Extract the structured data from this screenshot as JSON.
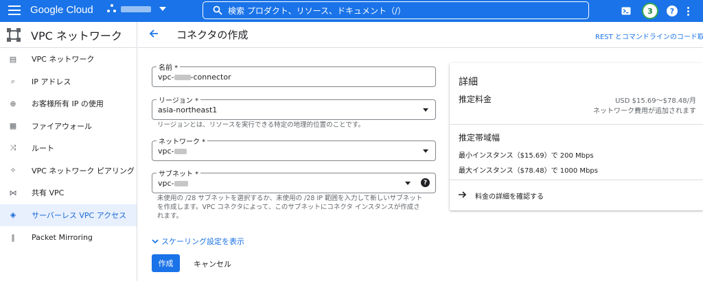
{
  "topbar": {
    "logo": "Google Cloud",
    "search_placeholder": "検索  プロダクト、リソース、ドキュメント（/）",
    "notifications_count": "3",
    "help_label": "?"
  },
  "sidebar": {
    "title": "VPC ネットワーク",
    "items": [
      {
        "label": "VPC ネットワーク",
        "icon": "vpc-networks-icon",
        "glyph": "▤"
      },
      {
        "label": "IP アドレス",
        "icon": "ip-address-icon",
        "glyph": "⌕"
      },
      {
        "label": "お客様所有 IP の使用",
        "icon": "globe-icon",
        "glyph": "⊕"
      },
      {
        "label": "ファイアウォール",
        "icon": "firewall-icon",
        "glyph": "▦"
      },
      {
        "label": "ルート",
        "icon": "routes-icon",
        "glyph": "⤨"
      },
      {
        "label": "VPC ネットワーク ピアリング",
        "icon": "peering-icon",
        "glyph": "✧"
      },
      {
        "label": "共有 VPC",
        "icon": "shared-vpc-icon",
        "glyph": "⋈"
      },
      {
        "label": "サーバーレス VPC アクセス",
        "icon": "serverless-icon",
        "glyph": "◈"
      },
      {
        "label": "Packet Mirroring",
        "icon": "packet-mirroring-icon",
        "glyph": "‖"
      }
    ],
    "active_index": 7
  },
  "header": {
    "title": "コネクタの作成",
    "rest_link": "REST とコマンドラインのコード取"
  },
  "form": {
    "name": {
      "label": "名前 *",
      "value_prefix": "vpc-",
      "value_suffix": "-connector"
    },
    "region": {
      "label": "リージョン *",
      "value": "asia-northeast1",
      "hint": "リージョンとは、リソースを実行できる特定の地理的位置のことです。"
    },
    "network": {
      "label": "ネットワーク *",
      "value_prefix": "vpc-"
    },
    "subnet": {
      "label": "サブネット *",
      "value_prefix": "vpc-",
      "hint_line1": "未使用の /28 サブネットを選択するか、未使用の /28 IP 範囲を入力して新しいサブネット",
      "hint_line2": "を作成します。VPC コネクタによって、このサブネットにコネクタ インスタンスが作成さ",
      "hint_line3": "れます。"
    },
    "scaling_link": "スケーリング設定を表示",
    "create_button": "作成",
    "cancel_button": "キャンセル"
  },
  "details": {
    "title": "詳細",
    "price_label": "推定料金",
    "price_value": "USD $15.69～$78.48/月",
    "price_note": "ネットワーク費用が追加されます",
    "bandwidth_title": "推定帯域幅",
    "bandwidth_min": "最小インスタンス（$15.69）で 200 Mbps",
    "bandwidth_max": "最大インスタンス（$78.48）で 1000 Mbps",
    "price_details_link": "料金の詳細を確認する"
  },
  "colors": {
    "accent": "#1a73e8",
    "active_bg": "#e8f0fe",
    "active_text": "#1967d2"
  }
}
